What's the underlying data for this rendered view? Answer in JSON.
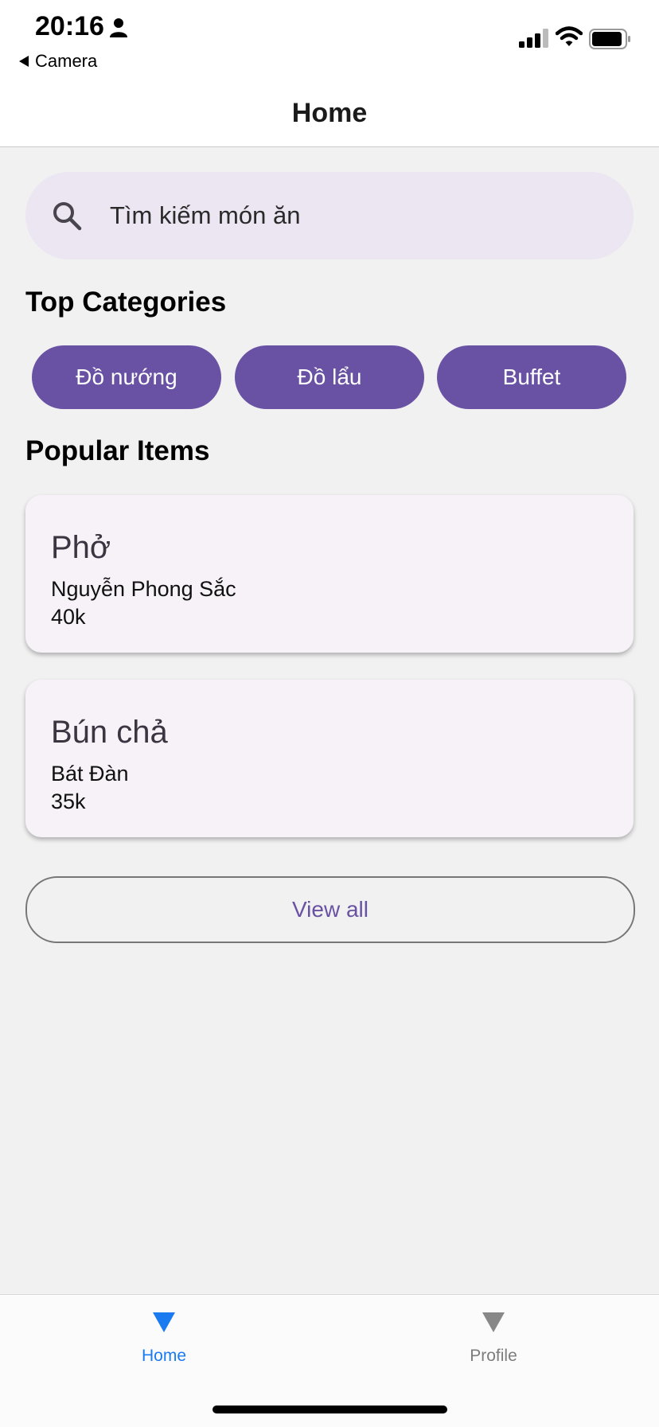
{
  "status_bar": {
    "time": "20:16",
    "back_label": "Camera",
    "icons": [
      "person-icon",
      "signal-icon",
      "wifi-icon",
      "battery-icon"
    ]
  },
  "nav": {
    "title": "Home"
  },
  "search": {
    "placeholder": "Tìm kiếm món ăn",
    "icon": "search-icon"
  },
  "top_categories": {
    "title": "Top Categories",
    "items": [
      {
        "label": "Đồ nướng"
      },
      {
        "label": "Đồ lẩu"
      },
      {
        "label": "Buffet"
      }
    ]
  },
  "popular_items": {
    "title": "Popular Items",
    "items": [
      {
        "name": "Phở",
        "place": "Nguyễn Phong Sắc",
        "price": "40k"
      },
      {
        "name": "Bún chả",
        "place": "Bát Đàn",
        "price": "35k"
      }
    ],
    "view_all_label": "View all"
  },
  "tab_bar": {
    "tabs": [
      {
        "label": "Home",
        "active": true
      },
      {
        "label": "Profile",
        "active": false
      }
    ]
  },
  "colors": {
    "accent": "#6952a4",
    "tab_active": "#1a7bf0",
    "search_bg": "#ebe6f1",
    "card_bg": "#f6f2f8",
    "page_bg": "#f1f1f1"
  }
}
